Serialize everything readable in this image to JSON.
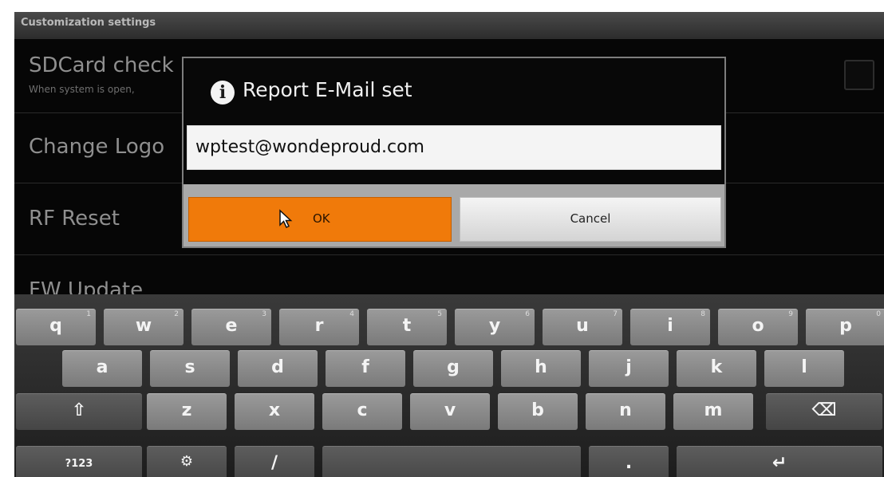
{
  "header": {
    "title": "Customization settings"
  },
  "settings": {
    "sdcard_title": "SDCard check",
    "sdcard_subtitle": "When system is open,",
    "change_logo": "Change Logo",
    "rf_reset": "RF Reset",
    "fw_update": "FW Update"
  },
  "dialog": {
    "icon": "info-icon",
    "icon_glyph": "i",
    "title": "Report E-Mail set",
    "input_value": "wptest@wondeproud.com",
    "ok_label": "OK",
    "cancel_label": "Cancel",
    "ok_color": "#f07a0a"
  },
  "keyboard": {
    "row1": [
      {
        "label": "q",
        "hint": "1"
      },
      {
        "label": "w",
        "hint": "2"
      },
      {
        "label": "e",
        "hint": "3"
      },
      {
        "label": "r",
        "hint": "4"
      },
      {
        "label": "t",
        "hint": "5"
      },
      {
        "label": "y",
        "hint": "6"
      },
      {
        "label": "u",
        "hint": "7"
      },
      {
        "label": "i",
        "hint": "8"
      },
      {
        "label": "o",
        "hint": "9"
      },
      {
        "label": "p",
        "hint": "0"
      }
    ],
    "row2": [
      "a",
      "s",
      "d",
      "f",
      "g",
      "h",
      "j",
      "k",
      "l"
    ],
    "row3": [
      "z",
      "x",
      "c",
      "v",
      "b",
      "n",
      "m"
    ],
    "shift_glyph": "⇧",
    "backspace_glyph": "⌫",
    "symbols_label": "?123",
    "settings_glyph": "⚙",
    "slash_label": "/",
    "period_label": ".",
    "enter_glyph": "↵"
  }
}
